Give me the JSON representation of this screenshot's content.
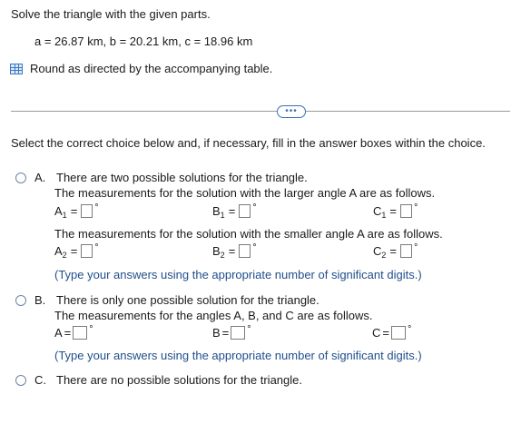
{
  "question": {
    "title": "Solve the triangle with the given parts.",
    "given": "a = 26.87 km, b = 20.21 km, c = 18.96 km",
    "table_link": "Round as directed by the accompanying table."
  },
  "more_label": "•••",
  "instruction": "Select the correct choice below and, if necessary, fill in the answer boxes within the choice.",
  "option_a": {
    "letter": "A.",
    "text": "There are two possible solutions for the triangle.",
    "larger_text": "The measurements for the solution with the larger angle A are as follows.",
    "smaller_text": "The measurements for the solution with the smaller angle A are as follows.",
    "note": "(Type your answers using the appropriate number of significant digits.)"
  },
  "option_b": {
    "letter": "B.",
    "text": "There is only one possible solution for the triangle.",
    "angles_text": "The measurements for the angles A, B, and C are as follows.",
    "note": "(Type your answers using the appropriate number of significant digits.)"
  },
  "option_c": {
    "letter": "C.",
    "text": "There are no possible solutions for the triangle."
  },
  "labels": {
    "A": "A",
    "B": "B",
    "C": "C",
    "sub1": "1",
    "sub2": "2",
    "eq": "=",
    "deg": "°"
  },
  "colors": {
    "accent": "#3a6fb0",
    "note": "#1f4e8c"
  }
}
